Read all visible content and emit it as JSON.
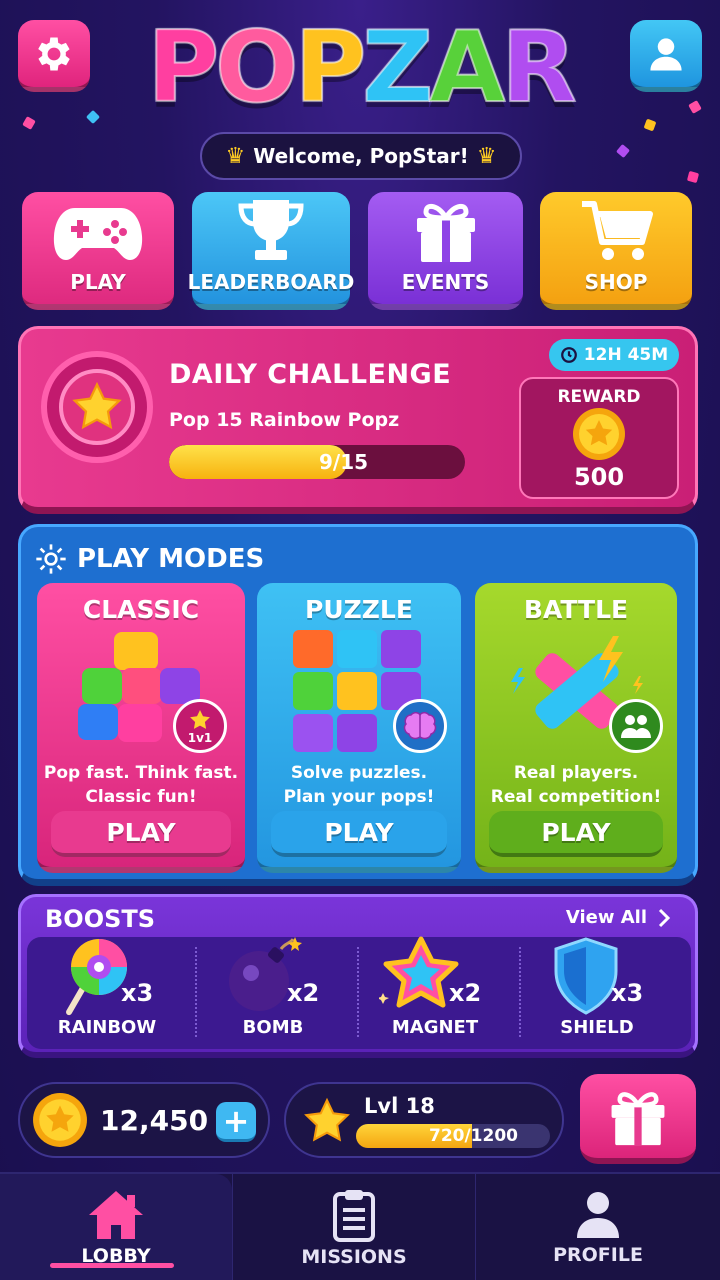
{
  "app": {
    "title": "POPZAR"
  },
  "header": {
    "logo_letters": [
      {
        "ch": "P",
        "color": "#ff3fa0"
      },
      {
        "ch": "O",
        "color": "#ff5b9e"
      },
      {
        "ch": "P",
        "color": "#ffc21f"
      },
      {
        "ch": "Z",
        "color": "#2fc3f5"
      },
      {
        "ch": "A",
        "color": "#58d13a"
      },
      {
        "ch": "R",
        "color": "#b04df0"
      }
    ],
    "welcome": "Welcome, PopStar!",
    "settings_icon": "gear-icon",
    "profile_icon": "user-icon"
  },
  "nav": [
    {
      "label": "PLAY",
      "icon": "gamepad-icon",
      "color": "#ff4fa3"
    },
    {
      "label": "LEADERBOARD",
      "icon": "trophy-icon",
      "color": "#2aa9ee"
    },
    {
      "label": "EVENTS",
      "icon": "gift-icon",
      "color": "#8e44e6"
    },
    {
      "label": "SHOP",
      "icon": "cart-icon",
      "color": "#ffb81c"
    }
  ],
  "daily": {
    "title": "DAILY CHALLENGE",
    "description": "Pop 15 Rainbow Popz",
    "progress_text": "9/15",
    "progress": 0.6,
    "timer": "12H 45M",
    "reward_label": "REWARD",
    "reward_amount": "500"
  },
  "modes": {
    "title": "PLAY MODES",
    "items": [
      {
        "title": "CLASSIC",
        "desc1": "Pop fast. Think fast.",
        "desc2": "Classic fun!",
        "play": "PLAY",
        "badge": "1v1"
      },
      {
        "title": "PUZZLE",
        "desc1": "Solve puzzles.",
        "desc2": "Plan your pops!",
        "play": "PLAY"
      },
      {
        "title": "BATTLE",
        "desc1": "Real players.",
        "desc2": "Real competition!",
        "play": "PLAY"
      }
    ]
  },
  "boosts": {
    "title": "BOOSTS",
    "view_all": "View All",
    "items": [
      {
        "name": "RAINBOW",
        "count": "x3",
        "icon": "lollipop-icon"
      },
      {
        "name": "BOMB",
        "count": "x2",
        "icon": "bomb-icon"
      },
      {
        "name": "MAGNET",
        "count": "x2",
        "icon": "star-icon"
      },
      {
        "name": "SHIELD",
        "count": "x3",
        "icon": "shield-icon"
      }
    ]
  },
  "wallet": {
    "coins": "12,450",
    "plus": "+"
  },
  "level": {
    "label": "Lvl 18",
    "progress_text": "720/1200",
    "progress": 0.6
  },
  "tabs": [
    {
      "label": "LOBBY",
      "icon": "home-icon",
      "active": true
    },
    {
      "label": "MISSIONS",
      "icon": "clipboard-icon",
      "active": false
    },
    {
      "label": "PROFILE",
      "icon": "person-icon",
      "active": false
    }
  ]
}
